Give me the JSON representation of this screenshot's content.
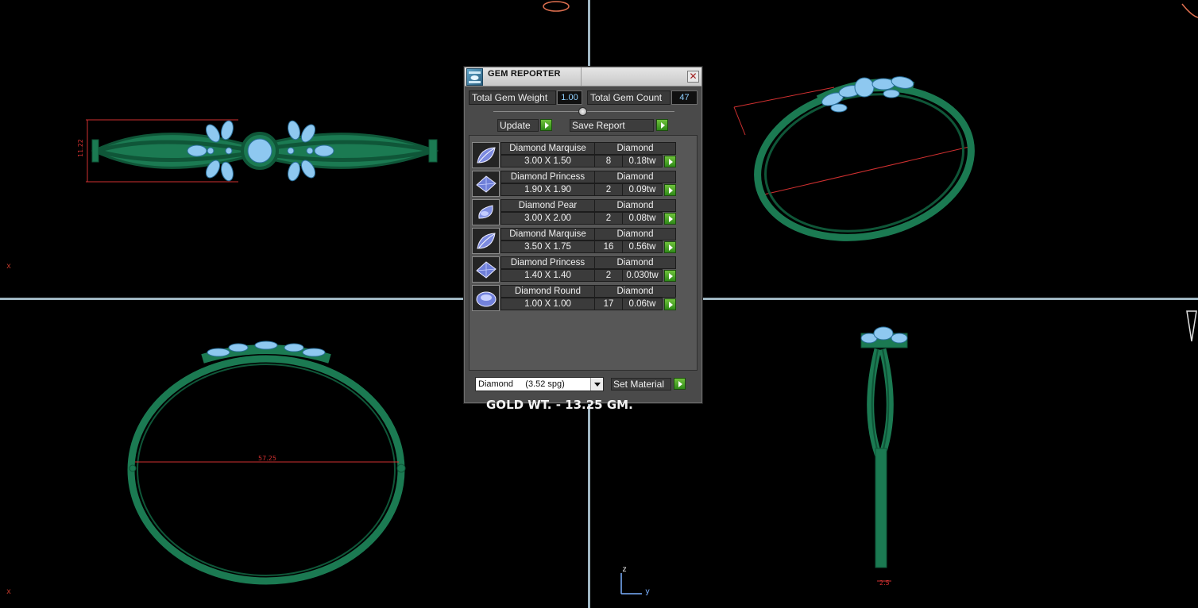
{
  "panel": {
    "title": "GEM REPORTER",
    "close_glyph": "✕",
    "total_weight_label": "Total Gem Weight",
    "total_weight_value": "1.00",
    "total_count_label": "Total Gem Count",
    "total_count_value": "47",
    "update_label": "Update",
    "save_report_label": "Save Report",
    "gems": [
      {
        "name": "Diamond Marquise",
        "material": "Diamond",
        "size": "3.00 X 1.50",
        "count": "8",
        "weight": "0.18tw",
        "shape_icon": "marquise-icon"
      },
      {
        "name": "Diamond Princess",
        "material": "Diamond",
        "size": "1.90 X 1.90",
        "count": "2",
        "weight": "0.09tw",
        "shape_icon": "princess-icon"
      },
      {
        "name": "Diamond Pear",
        "material": "Diamond",
        "size": "3.00 X 2.00",
        "count": "2",
        "weight": "0.08tw",
        "shape_icon": "pear-icon"
      },
      {
        "name": "Diamond Marquise",
        "material": "Diamond",
        "size": "3.50 X 1.75",
        "count": "16",
        "weight": "0.56tw",
        "shape_icon": "marquise-icon"
      },
      {
        "name": "Diamond Princess",
        "material": "Diamond",
        "size": "1.40 X 1.40",
        "count": "2",
        "weight": "0.030tw",
        "shape_icon": "princess-icon"
      },
      {
        "name": "Diamond Round",
        "material": "Diamond",
        "size": "1.00 X 1.00",
        "count": "17",
        "weight": "0.06tw",
        "shape_icon": "round-icon"
      }
    ],
    "note": "GOLD WT. - 13.25 GM.",
    "material_select": "Diamond     (3.52 spg)",
    "set_material_label": "Set Material"
  },
  "viewports": {
    "dim_height_top": "11.22",
    "dim_diameter_bottom": "57.25",
    "axis_x_1": "x",
    "axis_x_2": "x",
    "axis_z": "z",
    "axis_y": "y",
    "dim_shank": "2.5"
  },
  "colors": {
    "metal": "#1b7a52",
    "metal_dark": "#0f5638",
    "gem": "#8ec8f0",
    "dimension": "#d03030"
  }
}
